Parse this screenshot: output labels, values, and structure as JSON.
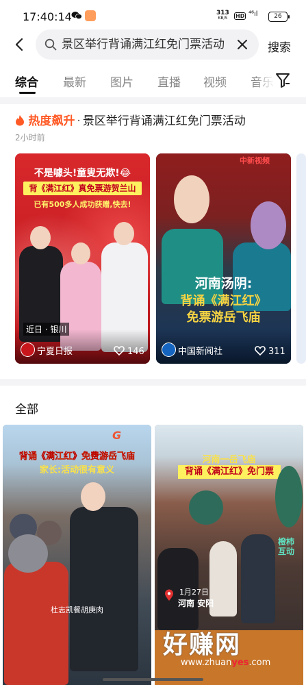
{
  "status_bar": {
    "time": "17:40:14",
    "speed_value": "313",
    "speed_unit": "KB/S",
    "hd": "HD",
    "network": "⁴⁶ıl",
    "battery": "26"
  },
  "search": {
    "query": "景区举行背诵满江红免门票活动",
    "button_label": "搜索"
  },
  "tabs": [
    {
      "label": "综合",
      "active": true
    },
    {
      "label": "最新"
    },
    {
      "label": "图片"
    },
    {
      "label": "直播"
    },
    {
      "label": "视频"
    },
    {
      "label": "音乐"
    }
  ],
  "hot_section": {
    "badge": "热度飙升",
    "separator": "·",
    "topic": "景区举行背诵满江红免门票活动",
    "time": "2小时前",
    "cards": [
      {
        "line1": "不是噱头!童叟无欺!😂",
        "line2": "背《满江红》真免票游贺兰山",
        "line3": "已有500多人成功获赠,快去!",
        "location": "近日 · 银川",
        "source": "宁夏日报",
        "likes": "146"
      },
      {
        "logo": "中新视频",
        "line1": "河南汤阴:",
        "line2": "背诵《满江红》",
        "line3": "免票游岳飞庙",
        "source": "中国新闻社",
        "likes": "311"
      }
    ]
  },
  "all_section": {
    "title": "全部",
    "videos": [
      {
        "logo": "G",
        "line1": "背诵《满江红》免费游岳飞庙",
        "line2": "家长:活动很有意义",
        "caption": "杜志凯餐胡庚肉"
      },
      {
        "line1": "河南一岳飞庙",
        "line2": "背诵《满江红》免门票",
        "date": "1月27日",
        "location": "河南 安阳",
        "side_text": "橙柿互动"
      }
    ]
  },
  "watermark": {
    "main": "好赚网",
    "sub_prefix": "www.zhuan",
    "sub_highlight": "yes",
    "sub_suffix": ".com"
  },
  "colors": {
    "hot_accent": "#ff5a26",
    "active_tab": "#111111",
    "inactive_tab": "#888888",
    "search_bg": "#f2f2f4"
  }
}
